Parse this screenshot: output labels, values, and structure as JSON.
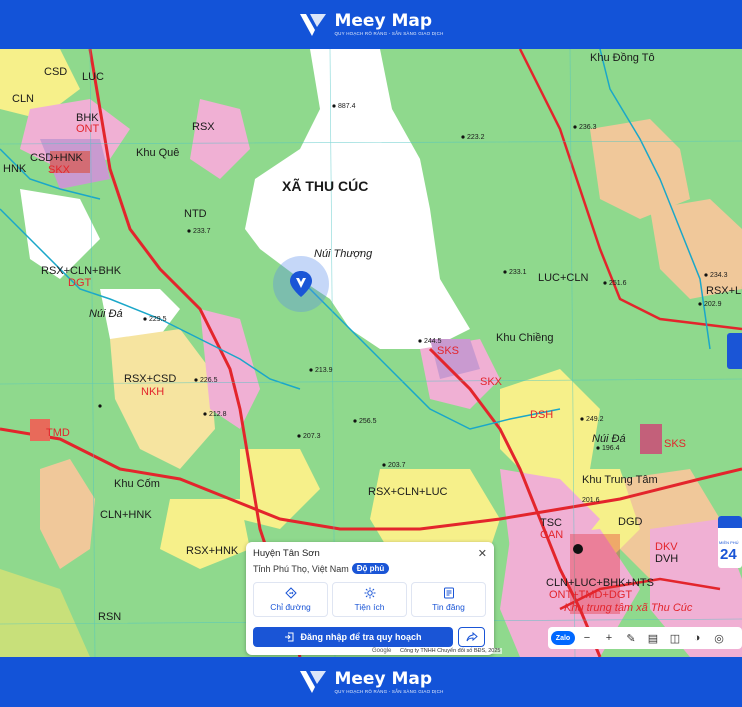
{
  "brand": {
    "name": "Meey Map",
    "tagline": "QUY HOẠCH RÕ RÀNG - SẴN SÀNG GIAO DỊCH"
  },
  "map": {
    "commune_label": "XÃ THU CÚC",
    "labels": [
      {
        "text": "LUC"
      },
      {
        "text": "CSD"
      },
      {
        "text": "CLN"
      },
      {
        "text": "RSX"
      },
      {
        "text": "ONT"
      },
      {
        "text": "BHK"
      },
      {
        "text": "HNK"
      },
      {
        "text": "NTD"
      },
      {
        "text": "CSD+HNK"
      },
      {
        "text": "SKX"
      },
      {
        "text": "Khu Quê"
      },
      {
        "text": "RSX+CLN+BHK"
      },
      {
        "text": "DGT"
      },
      {
        "text": "Núi Đá"
      },
      {
        "text": "RSX+CSD"
      },
      {
        "text": "NKH"
      },
      {
        "text": "TMD"
      },
      {
        "text": "Khu Cốm"
      },
      {
        "text": "CLN+HNK"
      },
      {
        "text": "RSX+HNK"
      },
      {
        "text": "RSN"
      },
      {
        "text": "Núi Thượng"
      },
      {
        "text": "SKS"
      },
      {
        "text": "SKX"
      },
      {
        "text": "Khu Chiềng"
      },
      {
        "text": "DSH"
      },
      {
        "text": "RSX+CLN+LUC"
      },
      {
        "text": "TSC"
      },
      {
        "text": "CAN"
      },
      {
        "text": "CLN+LUC+BHK+NTS"
      },
      {
        "text": "ONT+TMD+DGT"
      },
      {
        "text": "Khu trung tâm xã Thu Cúc"
      },
      {
        "text": "Núi Đá"
      },
      {
        "text": "Khu Trung Tâm"
      },
      {
        "text": "DGD"
      },
      {
        "text": "DKV"
      },
      {
        "text": "DVH"
      },
      {
        "text": "Khu Đồng Tô"
      },
      {
        "text": "RSX+LUC"
      },
      {
        "text": "LUC+CLN"
      },
      {
        "text": "SKS"
      }
    ],
    "elevations": [
      "887.4",
      "223.2",
      "236.3",
      "233.1",
      "251.6",
      "234.3",
      "233.7",
      "202.9",
      "229.5",
      "226.5",
      "212.8",
      "207.3",
      "213.9",
      "244.5",
      "256.5",
      "203.7",
      "249.2",
      "196.4",
      "201.6"
    ]
  },
  "info_card": {
    "title": "Huyện Tân Sơn",
    "subtitle": "Tỉnh Phú Thọ, Việt Nam",
    "badge": "Độ phủ",
    "actions": [
      {
        "label": "Chỉ đường",
        "icon": "directions-icon"
      },
      {
        "label": "Tiện ích",
        "icon": "utilities-icon"
      },
      {
        "label": "Tin đăng",
        "icon": "listing-icon"
      }
    ],
    "login_label": "Đăng nhập để tra quy hoạch",
    "share_icon": "share-icon"
  },
  "toolbar": {
    "zalo": "Zalo",
    "items": [
      "minus-icon",
      "plus-icon",
      "ruler-icon",
      "layers-icon",
      "split-icon",
      "compare-icon",
      "locate-icon"
    ]
  },
  "attribution": {
    "google": "Google",
    "copyright": "Công ty TNHH Chuyển đổi số BĐS, 2025"
  },
  "weather": {
    "value": "24",
    "label": "MIỀN PHÚ"
  },
  "colors": {
    "brand_blue": "#1353d8",
    "forest_green": "#8fd98d",
    "cropland": "#f6f08a",
    "residential": "#f0b0d4",
    "perennial": "#f0c89a",
    "road_red": "#e3252c",
    "bare_land": "#ffffff"
  }
}
